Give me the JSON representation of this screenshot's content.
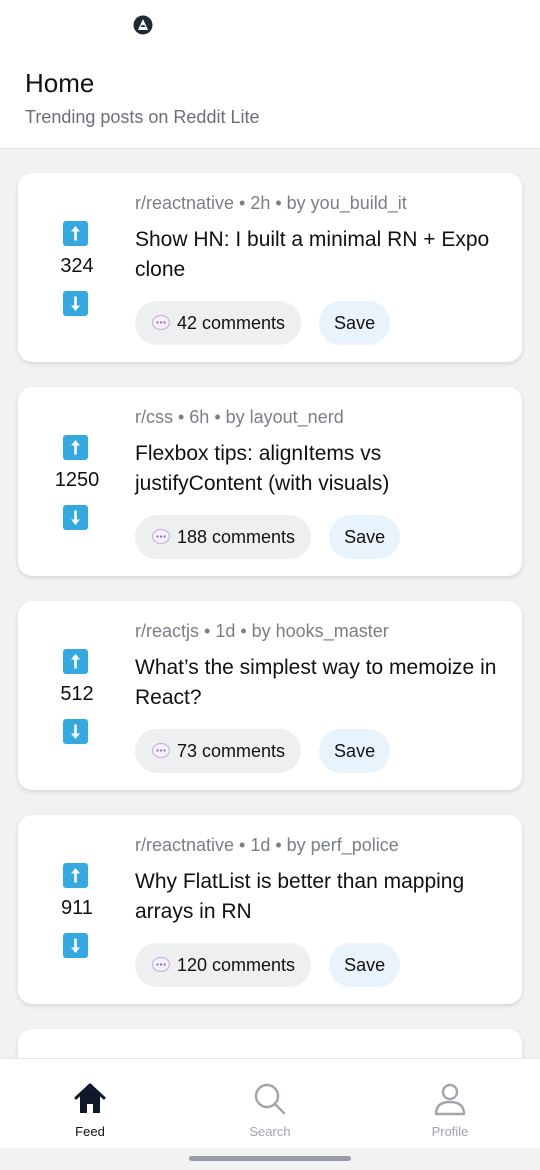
{
  "header": {
    "title": "Home",
    "subtitle": "Trending posts on Reddit Lite"
  },
  "posts": [
    {
      "meta": "r/reactnative • 2h • by you_build_it",
      "title": "Show HN: I built a minimal RN + Expo clone",
      "score": "324",
      "comments_label": "42 comments",
      "save_label": "Save"
    },
    {
      "meta": "r/css • 6h • by layout_nerd",
      "title": "Flexbox tips: alignItems vs justifyContent (with visuals)",
      "score": "1250",
      "comments_label": "188 comments",
      "save_label": "Save"
    },
    {
      "meta": "r/reactjs • 1d • by hooks_master",
      "title": "What’s the simplest way to memoize in React?",
      "score": "512",
      "comments_label": "73 comments",
      "save_label": "Save"
    },
    {
      "meta": "r/reactnative • 1d • by perf_police",
      "title": "Why FlatList is better than mapping arrays in RN",
      "score": "911",
      "comments_label": "120 comments",
      "save_label": "Save"
    }
  ],
  "tabs": [
    {
      "label": "Feed",
      "icon": "home-icon",
      "active": true
    },
    {
      "label": "Search",
      "icon": "search-icon",
      "active": false
    },
    {
      "label": "Profile",
      "icon": "person-icon",
      "active": false
    }
  ],
  "colors": {
    "accent": "#35a8e0",
    "save_bg": "#e9f3fc",
    "comments_bg": "#eeeff1",
    "active_tab": "#111111",
    "inactive_tab": "#a0a4ab"
  }
}
